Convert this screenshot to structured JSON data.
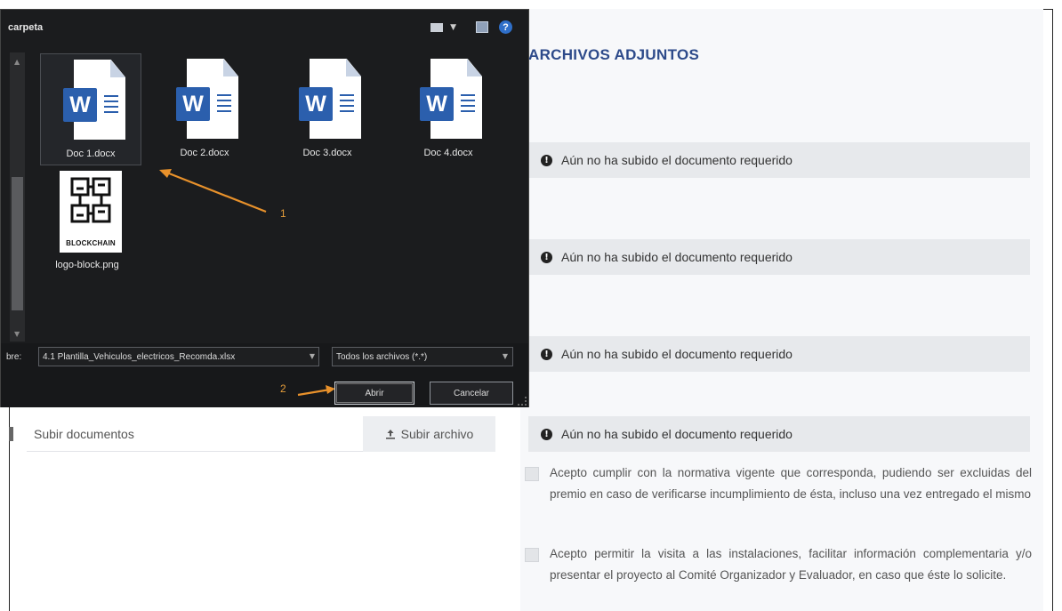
{
  "page": {
    "section_title": "ARCHIVOS ADJUNTOS",
    "notices": [
      {
        "text": "Aún no ha subido el documento requerido"
      },
      {
        "text": "Aún no ha subido el documento requerido"
      },
      {
        "text": "Aún no ha subido el documento requerido"
      },
      {
        "text": "Aún no ha subido el documento requerido"
      }
    ],
    "upload": {
      "placeholder": "Subir documentos",
      "button_label": "Subir archivo"
    },
    "checkboxes": [
      {
        "text": "Acepto cumplir con la normativa vigente que corresponda, pudiendo ser excluidas del premio en caso de verificarse incumplimiento de ésta, incluso una vez entregado el mismo"
      },
      {
        "text": "Acepto permitir la visita a las instalaciones, facilitar información complementaria y/o presentar el proyecto al Comité Organizador y Evaluador, en caso que éste lo solicite."
      }
    ]
  },
  "dialog": {
    "title_fragment": "carpeta",
    "files": [
      {
        "name": "Doc 1.docx",
        "icon": "word-document-icon"
      },
      {
        "name": "Doc 2.docx",
        "icon": "word-document-icon"
      },
      {
        "name": "Doc 3.docx",
        "icon": "word-document-icon"
      },
      {
        "name": "Doc 4.docx",
        "icon": "word-document-icon"
      },
      {
        "name": "logo-block.png",
        "icon": "blockchain-logo-icon",
        "logo_text": "BLOCKCHAIN"
      }
    ],
    "filename_label": "bre:",
    "filename_value": "4.1 Plantilla_Vehiculos_electricos_Recomda.xlsx",
    "filetype_value": "Todos los archivos (*.*)",
    "open_label": "Abrir",
    "cancel_label": "Cancelar",
    "word_letter": "W"
  },
  "annotations": {
    "step1": "1",
    "step2": "2",
    "arrow_color": "#e8912b"
  },
  "colors": {
    "title_blue": "#2d4a8a",
    "notice_bg": "#e7e9ec",
    "dialog_bg": "#1b1c1e",
    "word_blue": "#2b5fad"
  }
}
